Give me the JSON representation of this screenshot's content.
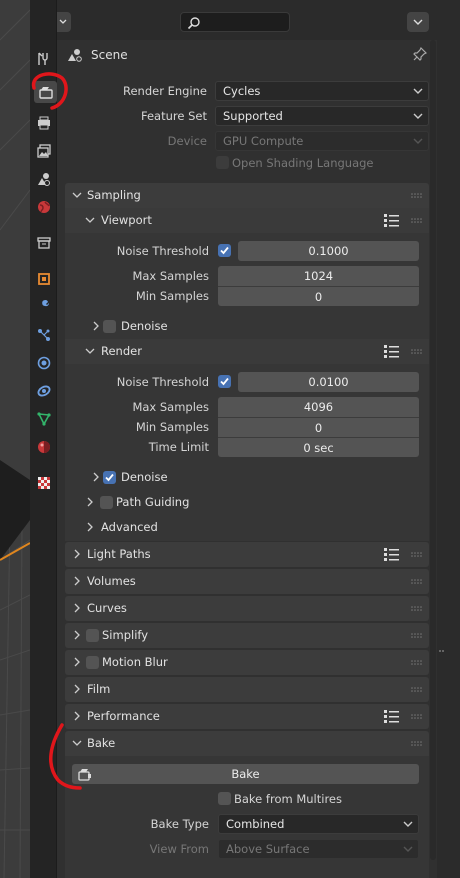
{
  "properties": {
    "context": {
      "title": "Scene"
    },
    "render": {
      "render_engine": {
        "label": "Render Engine",
        "value": "Cycles"
      },
      "feature_set": {
        "label": "Feature Set",
        "value": "Supported"
      },
      "device": {
        "label": "Device",
        "value": "GPU Compute"
      },
      "osl": {
        "label": "Open Shading Language",
        "checked": false
      }
    },
    "sampling": {
      "title": "Sampling",
      "viewport": {
        "title": "Viewport",
        "noise_threshold": {
          "label": "Noise Threshold",
          "checked": true,
          "value": "0.1000"
        },
        "max_samples": {
          "label": "Max Samples",
          "value": "1024"
        },
        "min_samples": {
          "label": "Min Samples",
          "value": "0"
        },
        "denoise": {
          "label": "Denoise",
          "checked": false
        }
      },
      "render": {
        "title": "Render",
        "noise_threshold": {
          "label": "Noise Threshold",
          "checked": true,
          "value": "0.0100"
        },
        "max_samples": {
          "label": "Max Samples",
          "value": "4096"
        },
        "min_samples": {
          "label": "Min Samples",
          "value": "0"
        },
        "time_limit": {
          "label": "Time Limit",
          "value": "0 sec"
        },
        "denoise": {
          "label": "Denoise",
          "checked": true
        }
      },
      "path_guiding": {
        "label": "Path Guiding",
        "checked": false
      },
      "advanced": {
        "label": "Advanced"
      }
    },
    "panels": {
      "light_paths": "Light Paths",
      "volumes": "Volumes",
      "curves": "Curves",
      "simplify": "Simplify",
      "motion_blur": "Motion Blur",
      "film": "Film",
      "performance": "Performance"
    },
    "bake": {
      "title": "Bake",
      "button_label": "Bake",
      "bake_from_multires": {
        "label": "Bake from Multires",
        "checked": false
      },
      "bake_type": {
        "label": "Bake Type",
        "value": "Combined"
      },
      "view_from": {
        "label": "View From",
        "value": "Above Surface"
      }
    }
  },
  "colors": {
    "accent": "#4772b3",
    "annotation": "#e0161b"
  }
}
